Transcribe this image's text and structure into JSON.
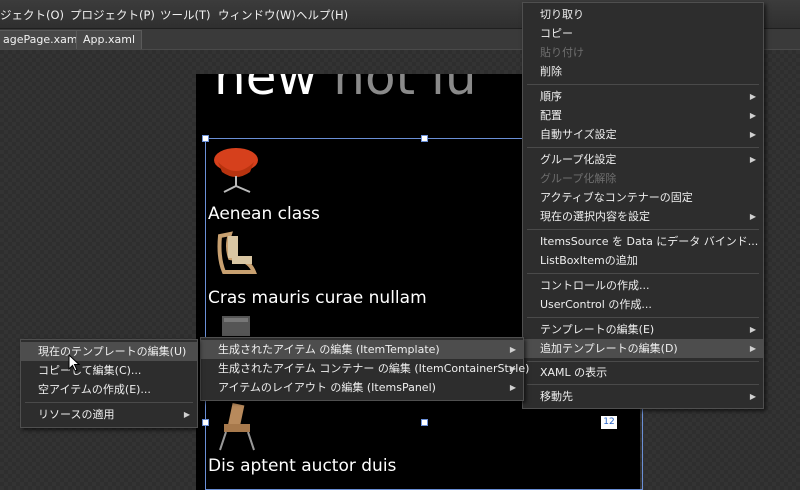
{
  "menubar": {
    "items": [
      "ジェクト(O)",
      "プロジェクト(P)",
      "ツール(T)",
      "ウィンドウ(W)",
      "ヘルプ(H)"
    ]
  },
  "tabs": [
    "agePage.xaml",
    "App.xaml"
  ],
  "artboard": {
    "headline_new": "new",
    "headline_rest": "hot iu",
    "items": [
      "Aenean class",
      "Cras mauris curae nullam",
      "Dis aptent auctor duis"
    ],
    "badge": "12"
  },
  "context_menu": {
    "cut": "切り取り",
    "copy": "コピー",
    "paste": "貼り付け",
    "delete": "削除",
    "order": "順序",
    "align": "配置",
    "autosize": "自動サイズ設定",
    "group": "グループ化設定",
    "ungroup": "グループ化解除",
    "pin_container": "アクティブなコンテナーの固定",
    "set_selection": "現在の選択内容を設定",
    "bind_items_source": "ItemsSource を Data にデータ バインド...",
    "add_listboxitem": "ListBoxItemの追加",
    "make_control": "コントロールの作成...",
    "make_usercontrol": "UserControl の作成...",
    "edit_template": "テンプレートの編集(E)",
    "edit_additional_templates": "追加テンプレートの編集(D)",
    "view_xaml": "XAML の表示",
    "navigate": "移動先"
  },
  "submenu_additional": {
    "item_template": "生成されたアイテム の編集 (ItemTemplate)",
    "item_container_style": "生成されたアイテム コンテナー の編集 (ItemContainerStyle)",
    "items_panel": "アイテムのレイアウト の編集 (ItemsPanel)"
  },
  "submenu_template": {
    "edit_current": "現在のテンプレートの編集(U)",
    "edit_copy": "コピーして編集(C)...",
    "create_empty": "空アイテムの作成(E)...",
    "apply_resource": "リソースの適用"
  }
}
